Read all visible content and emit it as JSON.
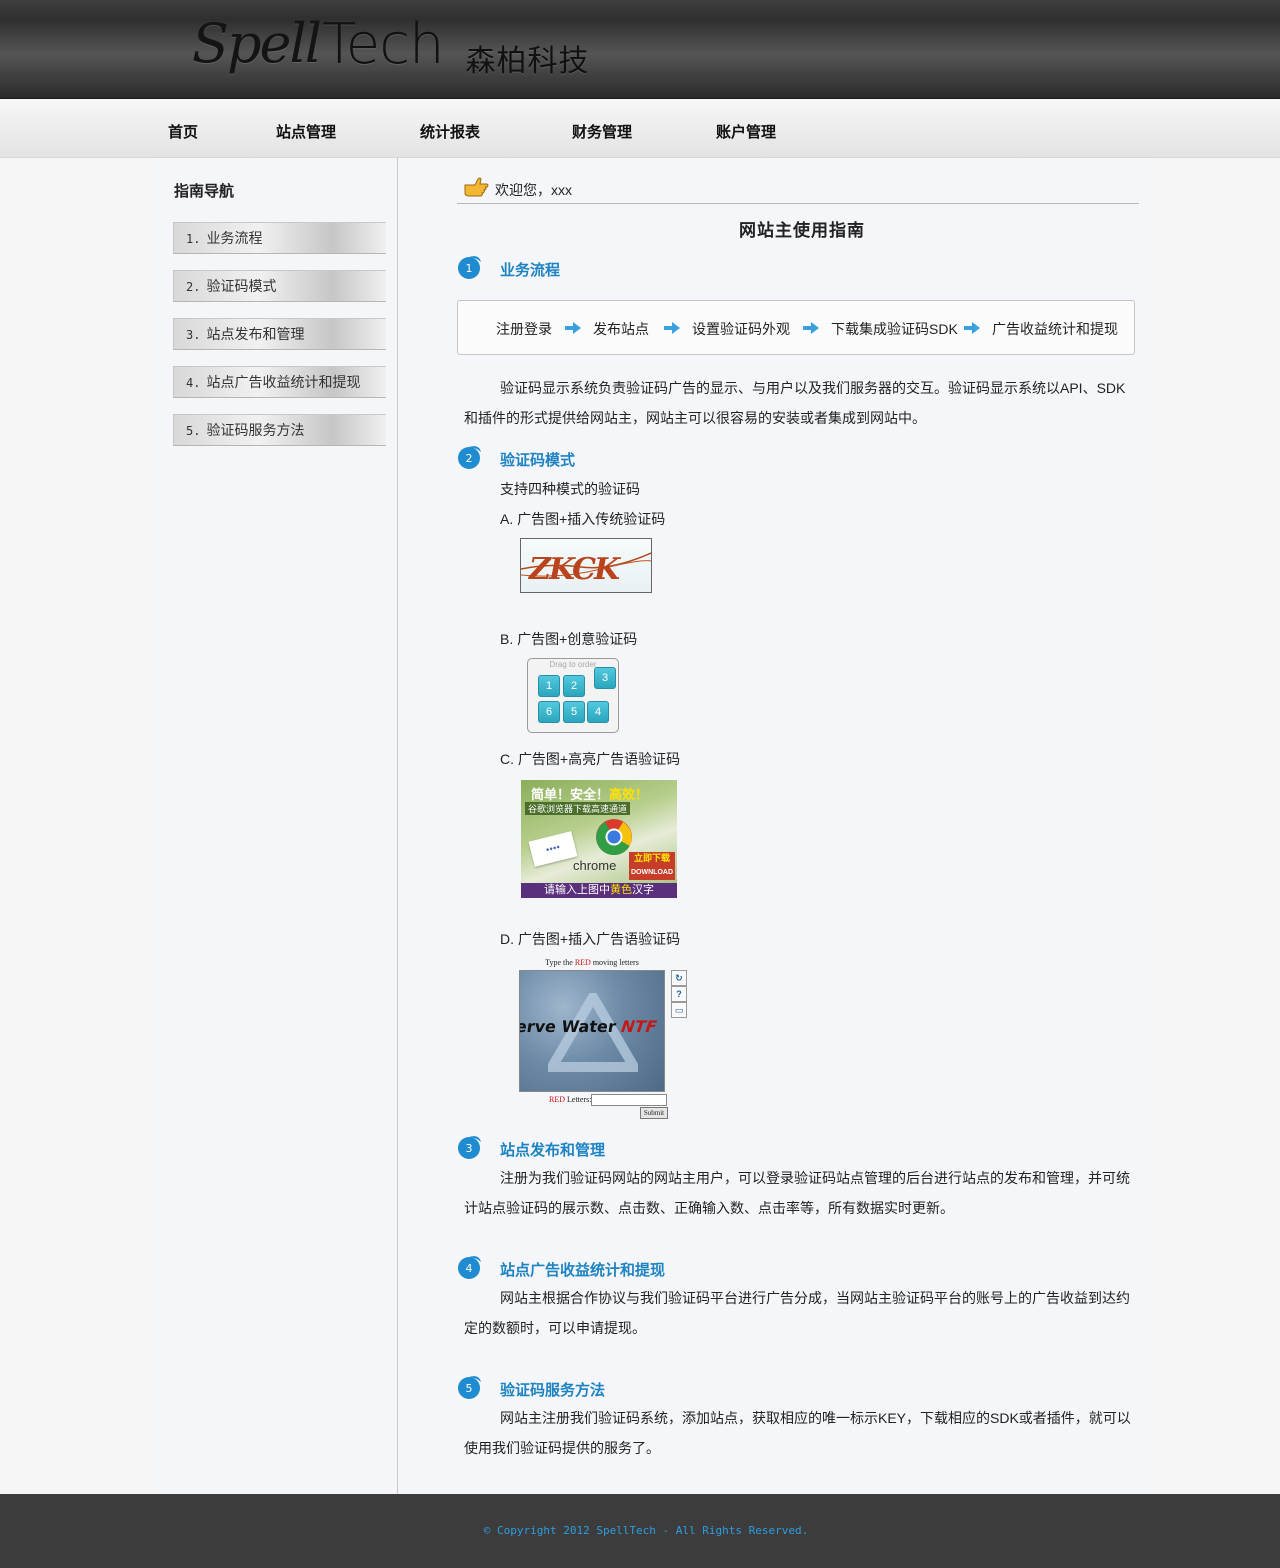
{
  "header": {
    "logo_script": "Spell",
    "logo_tech": "Tech",
    "logo_cn": "森柏科技"
  },
  "nav": {
    "items": [
      {
        "label": "首页"
      },
      {
        "label": "站点管理"
      },
      {
        "label": "统计报表"
      },
      {
        "label": "财务管理"
      },
      {
        "label": "账户管理"
      }
    ]
  },
  "sidebar": {
    "title": "指南导航",
    "items": [
      {
        "num": "1.",
        "label": "业务流程"
      },
      {
        "num": "2.",
        "label": "验证码模式"
      },
      {
        "num": "3.",
        "label": "站点发布和管理"
      },
      {
        "num": "4.",
        "label": "站点广告收益统计和提现"
      },
      {
        "num": "5.",
        "label": "验证码服务方法"
      }
    ]
  },
  "main": {
    "welcome": "欢迎您，xxx",
    "page_title": "网站主使用指南",
    "sections": [
      {
        "num": "1",
        "title": "业务流程"
      },
      {
        "num": "2",
        "title": "验证码模式"
      },
      {
        "num": "3",
        "title": "站点发布和管理"
      },
      {
        "num": "4",
        "title": "站点广告收益统计和提现"
      },
      {
        "num": "5",
        "title": "验证码服务方法"
      }
    ],
    "flow": [
      "注册登录",
      "发布站点",
      "设置验证码外观",
      "下载集成验证码SDK",
      "广告收益统计和提现"
    ],
    "section1_text": "验证码显示系统负责验证码广告的显示、与用户以及我们服务器的交互。验证码显示系统以API、SDK和插件的形式提供给网站主，网站主可以很容易的安装或者集成到网站中。",
    "section2_intro": "支持四种模式的验证码",
    "modes": [
      {
        "label": "A. 广告图+插入传统验证码"
      },
      {
        "label": "B. 广告图+创意验证码"
      },
      {
        "label": "C. 广告图+高亮广告语验证码"
      },
      {
        "label": "D. 广告图+插入广告语验证码"
      }
    ],
    "section3_text": "注册为我们验证码网站的网站主用户，可以登录验证码站点管理的后台进行站点的发布和管理，并可统计站点验证码的展示数、点击数、正确输入数、点击率等，所有数据实时更新。",
    "section4_text": "网站主根据合作协议与我们验证码平台进行广告分成，当网站主验证码平台的账号上的广告收益到达约定的数额时，可以申请提现。",
    "section5_text": "网站主注册我们验证码系统，添加站点，获取相应的唯一标示KEY，下载相应的SDK或者插件，就可以使用我们验证码提供的服务了。"
  },
  "captcha_a": {
    "text": "ZKCK"
  },
  "captcha_b": {
    "hint": "Drag to order",
    "tiles": [
      "1",
      "2",
      "3",
      "6",
      "5",
      "4"
    ]
  },
  "captcha_c": {
    "line1_a": "简单！安全！",
    "line1_b": "高效！",
    "line2": "谷歌浏览器下载高速通道",
    "chrome": "chrome",
    "download_cn": "立即下载",
    "download_en": "DOWNLOAD",
    "bottom_a": "请输入上图中",
    "bottom_b": "黄色",
    "bottom_c": "汉字"
  },
  "captcha_d": {
    "top_a": "Type the ",
    "top_red": "RED",
    "top_b": " moving letters",
    "word_a": "erve Water ",
    "word_b": "NTF",
    "label_red": "RED",
    "label_rest": " Letters:",
    "submit": "Submit",
    "btn_refresh": "↻",
    "btn_help": "?",
    "btn_audio": "▭"
  },
  "footer": {
    "copyright": "© Copyright 2012 SpellTech - All Rights Reserved."
  },
  "colors": {
    "accent": "#1e83c2",
    "footer_bg": "#3c3c3c",
    "copyright": "#2d9ee0"
  }
}
